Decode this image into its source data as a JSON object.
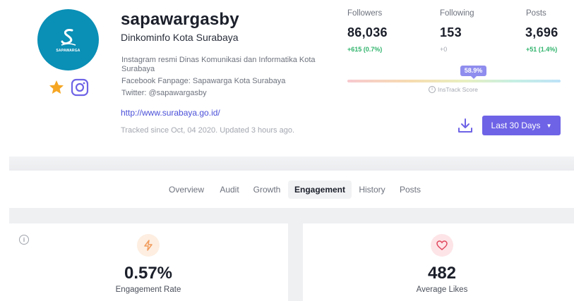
{
  "profile": {
    "avatar_caption": "SAPAWARGA",
    "username": "sapawargasby",
    "full_name": "Dinkominfo Kota Surabaya",
    "bio": [
      "Instagram resmi Dinas Komunikasi dan Informatika Kota",
      "Surabaya",
      "Facebook Fanpage: Sapawarga Kota Surabaya",
      "Twitter: @sapawargasby"
    ],
    "website": "http://www.surabaya.go.id/",
    "tracked_text": "Tracked since Oct, 04 2020. Updated 3 hours ago.",
    "icons": {
      "favorite": "star-icon",
      "platform": "instagram-icon"
    },
    "brand_color": "#0a8fb6"
  },
  "stats": {
    "followers": {
      "label": "Followers",
      "value": "86,036",
      "change": "+615 (0.7%)"
    },
    "following": {
      "label": "Following",
      "value": "153",
      "change": "+0"
    },
    "posts": {
      "label": "Posts",
      "value": "3,696",
      "change": "+51 (1.4%)"
    }
  },
  "instrack": {
    "score_text": "58.9%",
    "score_fraction": 0.589,
    "label": "InsTrack Score"
  },
  "actions": {
    "range_button": "Last 30 Days",
    "download_icon": "download-icon",
    "accent": "#6e63e6"
  },
  "tabs": [
    {
      "label": "Overview"
    },
    {
      "label": "Audit"
    },
    {
      "label": "Growth"
    },
    {
      "label": "Engagement",
      "active": true
    },
    {
      "label": "History"
    },
    {
      "label": "Posts"
    }
  ],
  "metrics": {
    "engagement_rate": {
      "value": "0.57%",
      "label": "Engagement Rate",
      "icon": "bolt-icon"
    },
    "average_likes": {
      "value": "482",
      "label": "Average Likes",
      "icon": "heart-icon"
    }
  }
}
